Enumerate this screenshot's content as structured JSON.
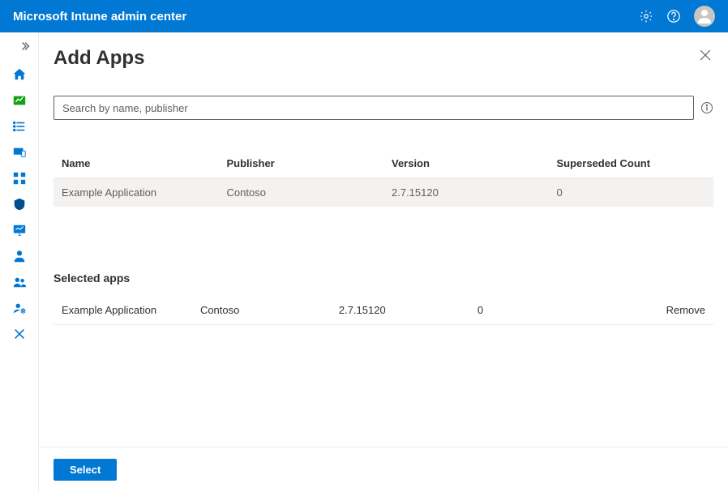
{
  "topbar": {
    "title": "Microsoft Intune admin center"
  },
  "page": {
    "title": "Add Apps"
  },
  "search": {
    "placeholder": "Search by name, publisher",
    "value": ""
  },
  "results_table": {
    "columns": {
      "name": "Name",
      "publisher": "Publisher",
      "version": "Version",
      "superseded_count": "Superseded Count"
    },
    "rows": [
      {
        "name": "Example Application",
        "publisher": "Contoso",
        "version": "2.7.15120",
        "superseded_count": "0"
      }
    ]
  },
  "selected_section": {
    "title": "Selected apps",
    "rows": [
      {
        "name": "Example Application",
        "publisher": "Contoso",
        "version": "2.7.15120",
        "superseded_count": "0",
        "remove_label": "Remove"
      }
    ]
  },
  "footer": {
    "select_label": "Select"
  }
}
